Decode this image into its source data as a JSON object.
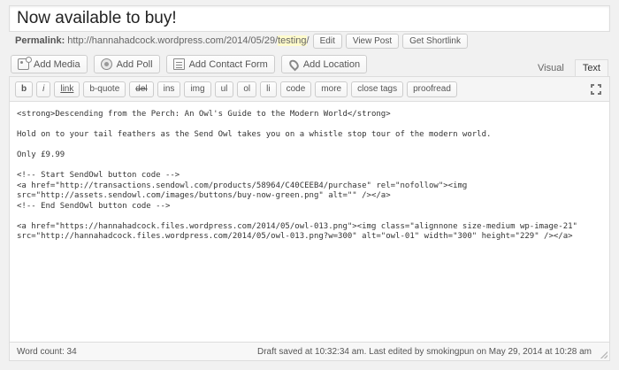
{
  "post": {
    "title": "Now available to buy!"
  },
  "permalink": {
    "label": "Permalink:",
    "base": "http://hannahadcock.wordpress.com/2014/05/29/",
    "slug": "testing",
    "trail": "/",
    "edit": "Edit",
    "view": "View Post",
    "shortlink": "Get Shortlink"
  },
  "media_buttons": [
    {
      "label": "Add Media",
      "icon": "media-icon"
    },
    {
      "label": "Add Poll",
      "icon": "poll-icon"
    },
    {
      "label": "Add Contact Form",
      "icon": "form-icon"
    },
    {
      "label": "Add Location",
      "icon": "location-icon"
    }
  ],
  "tabs": {
    "visual": "Visual",
    "text": "Text"
  },
  "toolbar": [
    "b",
    "i",
    "link",
    "b-quote",
    "del",
    "ins",
    "img",
    "ul",
    "ol",
    "li",
    "code",
    "more",
    "close tags",
    "proofread"
  ],
  "content": "<strong>Descending from the Perch: An Owl's Guide to the Modern World</strong>\n\nHold on to your tail feathers as the Send Owl takes you on a whistle stop tour of the modern world.\n\nOnly £9.99\n\n<!-- Start SendOwl button code -->\n<a href=\"http://transactions.sendowl.com/products/58964/C40CEEB4/purchase\" rel=\"nofollow\"><img\nsrc=\"http://assets.sendowl.com/images/buttons/buy-now-green.png\" alt=\"\" /></a>\n<!-- End SendOwl button code -->\n\n<a href=\"https://hannahadcock.files.wordpress.com/2014/05/owl-013.png\"><img class=\"alignnone size-medium wp-image-21\"\nsrc=\"http://hannahadcock.files.wordpress.com/2014/05/owl-013.png?w=300\" alt=\"owl-01\" width=\"300\" height=\"229\" /></a>",
  "status": {
    "word_count": "Word count: 34",
    "draft": "Draft saved at 10:32:34 am. Last edited by smokingpun on May 29, 2014 at 10:28 am"
  }
}
